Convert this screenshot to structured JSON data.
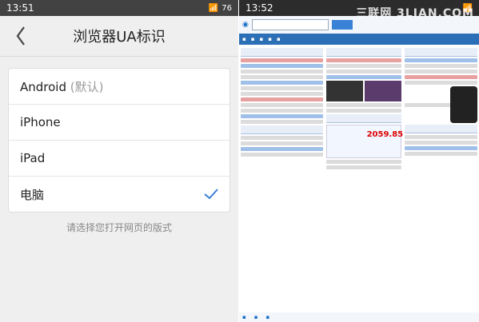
{
  "left": {
    "status_time": "13:51",
    "battery": "76",
    "nav_title": "浏览器UA标识",
    "options": [
      {
        "label": "Android",
        "hint": "(默认)"
      },
      {
        "label": "iPhone",
        "hint": ""
      },
      {
        "label": "iPad",
        "hint": ""
      },
      {
        "label": "电脑",
        "hint": ""
      }
    ],
    "selected_index": 3,
    "footer_hint": "请选择您打开网页的版式"
  },
  "right": {
    "status_time": "13:52",
    "watermark": "三联网 3LIAN.COM",
    "stock_value": "2059.85"
  },
  "colors": {
    "check": "#3b7fd8"
  }
}
